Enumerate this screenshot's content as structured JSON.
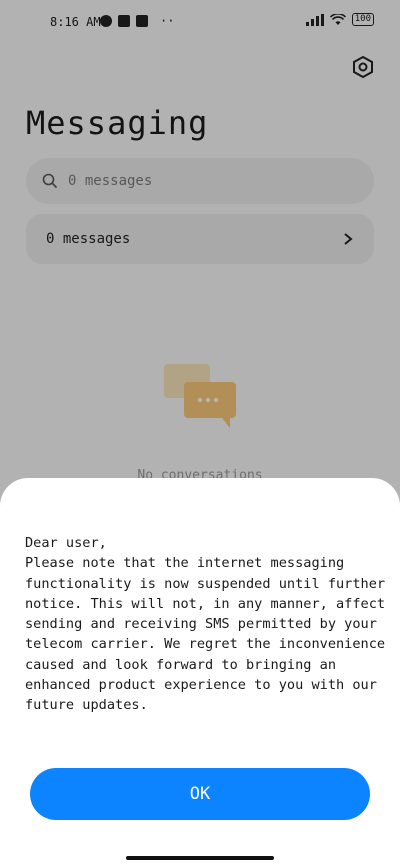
{
  "status_bar": {
    "time": "8:16 AM",
    "battery": "100"
  },
  "app": {
    "title": "Messaging",
    "search_placeholder": "0 messages",
    "row_label": "0 messages",
    "empty_text": "No conversations"
  },
  "dialog": {
    "message": "Dear user,\nPlease note that the internet messaging functionality is now suspended until further notice. This will not, in any manner, affect sending and receiving SMS permitted by your telecom carrier. We regret the inconvenience caused and look forward to bringing an enhanced product experience to you with our future updates.",
    "ok_label": "OK"
  },
  "colors": {
    "accent": "#0d84ff",
    "scrim": "rgba(0,0,0,0.28)",
    "illustration": "#f6c778"
  },
  "icons": [
    "settings-icon",
    "search-icon",
    "chevron-right-icon",
    "chat-bubbles-icon",
    "signal-icon",
    "wifi-icon",
    "battery-icon"
  ]
}
